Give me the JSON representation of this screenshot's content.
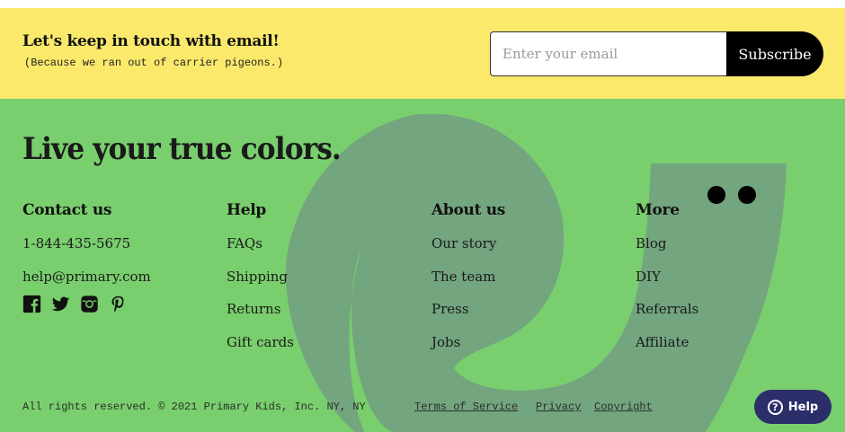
{
  "newsletter": {
    "heading": "Let's keep in touch with email!",
    "subheading": "(Because we ran out of carrier pigeons.)",
    "email_placeholder": "Enter your email",
    "email_value": "",
    "subscribe_label": "Subscribe"
  },
  "footer": {
    "tagline": "Live your true colors.",
    "columns": [
      {
        "title": "Contact us",
        "items": [
          "1-844-435-5675",
          "help@primary.com"
        ]
      },
      {
        "title": "Help",
        "items": [
          "FAQs",
          "Shipping",
          "Returns",
          "Gift cards"
        ]
      },
      {
        "title": "About us",
        "items": [
          "Our story",
          "The team",
          "Press",
          "Jobs"
        ]
      },
      {
        "title": "More",
        "items": [
          "Blog",
          "DIY",
          "Referrals",
          "Affiliate"
        ]
      }
    ],
    "social_icons": [
      "facebook-icon",
      "twitter-icon",
      "instagram-icon",
      "pinterest-icon"
    ],
    "legal_text": "All rights reserved. © 2021 Primary Kids, Inc. NY, NY",
    "legal_links": [
      "Terms of Service",
      "Privacy",
      "Copyright"
    ]
  },
  "help_widget": {
    "label": "Help",
    "icon": "question-circle-icon"
  },
  "colors": {
    "newsletter_bg": "#fbe96c",
    "footer_bg": "#79cf6d",
    "mascot": "#73a57f",
    "help_button": "#2c2e6a"
  }
}
